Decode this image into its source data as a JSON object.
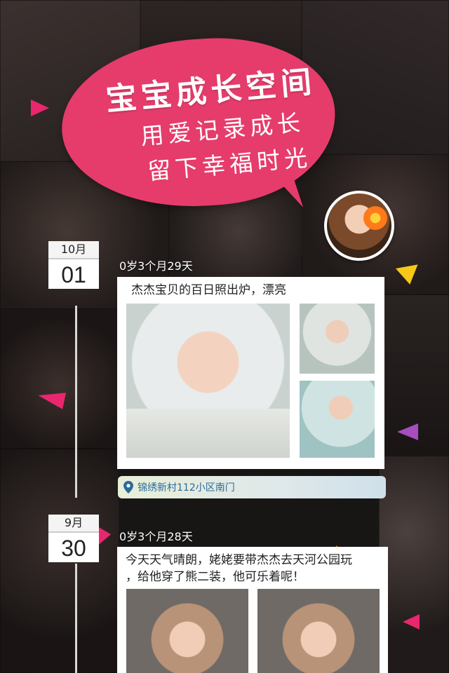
{
  "header": {
    "title": "宝宝成长空间",
    "line1": "用爱记录成长",
    "line2": "留下幸福时光"
  },
  "posts": [
    {
      "month": "10月",
      "day": "01",
      "age": "0岁3个月29天",
      "text": "杰杰宝贝的百日照出炉，漂亮",
      "location": "锦绣新村112小区南门"
    },
    {
      "month": "9月",
      "day": "30",
      "age": "0岁3个月28天",
      "text_line1": "今天天气晴朗，姥姥要带杰杰去天河公园玩",
      "text_line2": "，给他穿了熊二装，他可乐着呢！"
    }
  ],
  "colors": {
    "bubble": "#e63c6b",
    "accent_pink": "#e8276e",
    "accent_yellow": "#f6c81a",
    "accent_purple": "#a64dc0",
    "accent_orange": "#f7a21a",
    "location_text": "#2b6b9c"
  },
  "icons": {
    "location": "map-pin-icon"
  }
}
